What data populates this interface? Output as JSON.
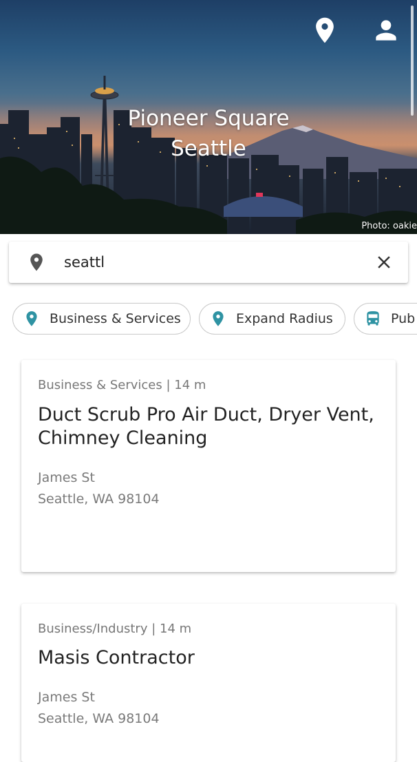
{
  "hero": {
    "title_line1": "Pioneer Square",
    "title_line2": "Seattle",
    "photo_credit": "Photo: oakie",
    "location_icon": "location-pin-icon",
    "account_icon": "account-icon"
  },
  "search": {
    "value": "seattl",
    "icon": "location-pin-icon",
    "clear_icon": "close-icon"
  },
  "chips": [
    {
      "label": "Business & Services",
      "icon": "location-pin-icon"
    },
    {
      "label": "Expand Radius",
      "icon": "location-pin-icon"
    },
    {
      "label": "Pub",
      "icon": "bus-icon"
    }
  ],
  "results": [
    {
      "meta": "Business & Services | 14 m",
      "name": "Duct Scrub Pro Air Duct, Dryer Vent, Chimney Cleaning",
      "street": "James St",
      "city": "Seattle, WA 98104"
    },
    {
      "meta": "Business/Industry | 14 m",
      "name": "Masis Contractor",
      "street": "James St",
      "city": "Seattle, WA 98104"
    }
  ],
  "colors": {
    "accent": "#2f93a3",
    "icon_gray": "#555555"
  }
}
